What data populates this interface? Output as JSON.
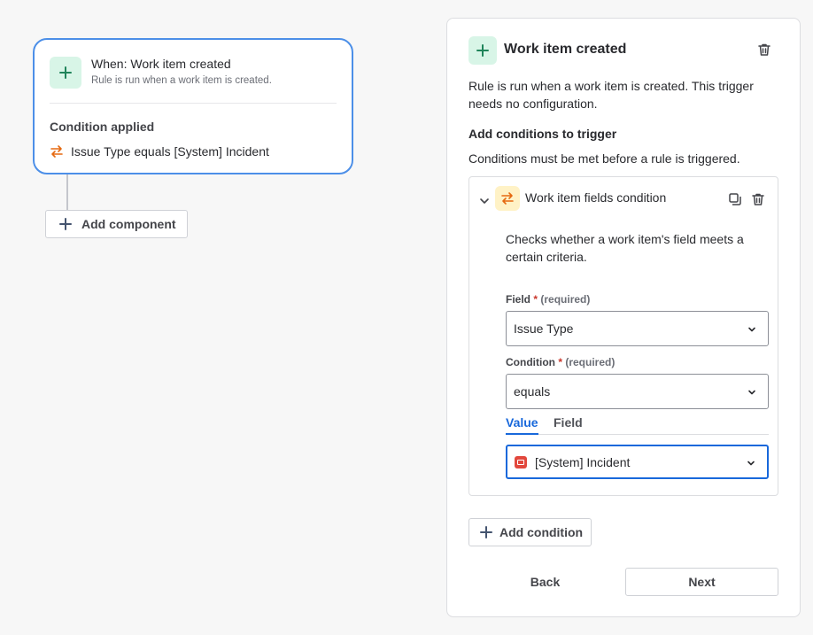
{
  "trigger_card": {
    "title": "When: Work item created",
    "subtitle": "Rule is run when a work item is created.",
    "condition_heading": "Condition applied",
    "condition_text": "Issue Type equals [System] Incident",
    "icon": "plus-icon"
  },
  "canvas": {
    "add_component_label": "Add component"
  },
  "panel": {
    "title": "Work item created",
    "description": "Rule is run when a work item is created. This trigger needs no configuration.",
    "conditions_heading": "Add conditions to trigger",
    "conditions_subtext": "Conditions must be met before a rule is triggered.",
    "condition_block": {
      "title": "Work item fields condition",
      "description": "Checks whether a work item's field meets a certain criteria.",
      "field_label": "Field",
      "field_required": "(required)",
      "field_value": "Issue Type",
      "condition_label": "Condition",
      "condition_required": "(required)",
      "condition_value": "equals",
      "tabs": [
        {
          "label": "Value",
          "active": true
        },
        {
          "label": "Field",
          "active": false
        }
      ],
      "value_selected": "[System] Incident"
    },
    "add_condition_label": "Add condition",
    "back_label": "Back",
    "next_label": "Next"
  },
  "colors": {
    "accent": "#1868db",
    "focus_border": "#4c8fe8",
    "trigger_icon_bg": "#d8f5e7",
    "condition_icon_bg": "#fff2c6",
    "condition_icon_fg": "#e56910",
    "incident_icon": "#e2483d",
    "required_star": "#c9372c"
  }
}
